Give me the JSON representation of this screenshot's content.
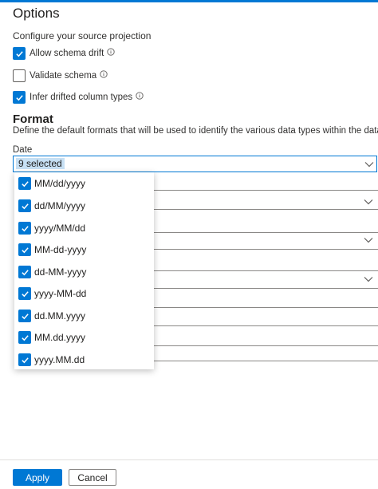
{
  "header": {
    "title": "Options"
  },
  "projection": {
    "subtitle": "Configure your source projection",
    "options": [
      {
        "label": "Allow schema drift",
        "checked": true
      },
      {
        "label": "Validate schema",
        "checked": false
      },
      {
        "label": "Infer drifted column types",
        "checked": true
      }
    ]
  },
  "format": {
    "title": "Format",
    "description": "Define the default formats that will be used to identify the various data types within the dataset"
  },
  "date": {
    "label": "Date",
    "value": "9 selected",
    "options": [
      "MM/dd/yyyy",
      "dd/MM/yyyy",
      "yyyy/MM/dd",
      "MM-dd-yyyy",
      "dd-MM-yyyy",
      "yyyy-MM-dd",
      "dd.MM.yyyy",
      "MM.dd.yyyy",
      "yyyy.MM.dd"
    ]
  },
  "footer": {
    "apply_label": "Apply",
    "cancel_label": "Cancel"
  },
  "colors": {
    "accent": "#0078d4",
    "selection": "#c7e0f4"
  }
}
